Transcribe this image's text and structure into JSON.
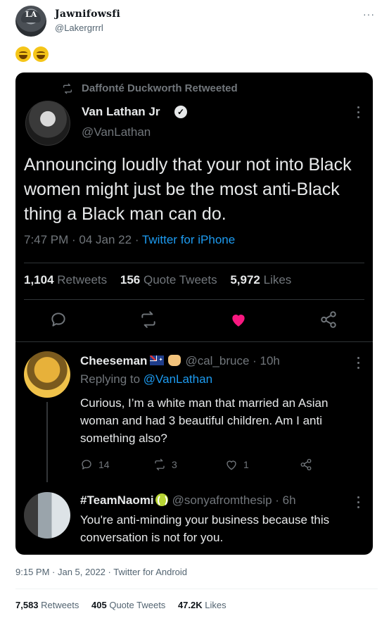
{
  "outer": {
    "display_name": "Jawnifowsfi",
    "handle": "@Lakergrrrl",
    "avatar_text": "LA",
    "emoji_count": 2
  },
  "quoted": {
    "retweet_label": "Daffonté Duckworth Retweeted",
    "author_name": "Van Lathan Jr",
    "author_handle": "@VanLathan",
    "verified": true,
    "text": "Announcing loudly that your not into Black women might just be the most anti-Black thing a Black man can do.",
    "time": "7:47 PM · 04 Jan 22 · ",
    "source": "Twitter for iPhone",
    "stats": {
      "retweets": "1,104",
      "retweets_label": "Retweets",
      "quotes": "156",
      "quotes_label": "Quote Tweets",
      "likes": "5,972",
      "likes_label": "Likes"
    },
    "like_color": "#f91880"
  },
  "replies": [
    {
      "name": "Cheeseman",
      "handle": "@cal_bruce",
      "age": "10h",
      "replying_to_prefix": "Replying to ",
      "replying_to": "@VanLathan",
      "text": "Curious, I’m a white man that married an Asian woman and had 3 beautiful children. Am I anti something also?",
      "replies": "14",
      "retweets": "3",
      "likes": "1"
    },
    {
      "name": "#TeamNaomi",
      "handle": "@sonyafromthesip",
      "age": "6h",
      "text": "You're anti-minding your business because this conversation is not for you."
    }
  ],
  "footer": {
    "timestamp": "9:15 PM · Jan 5, 2022 · Twitter for Android",
    "retweets": "7,583",
    "retweets_label": "Retweets",
    "quotes": "405",
    "quotes_label": "Quote Tweets",
    "likes": "47.2K",
    "likes_label": "Likes"
  }
}
